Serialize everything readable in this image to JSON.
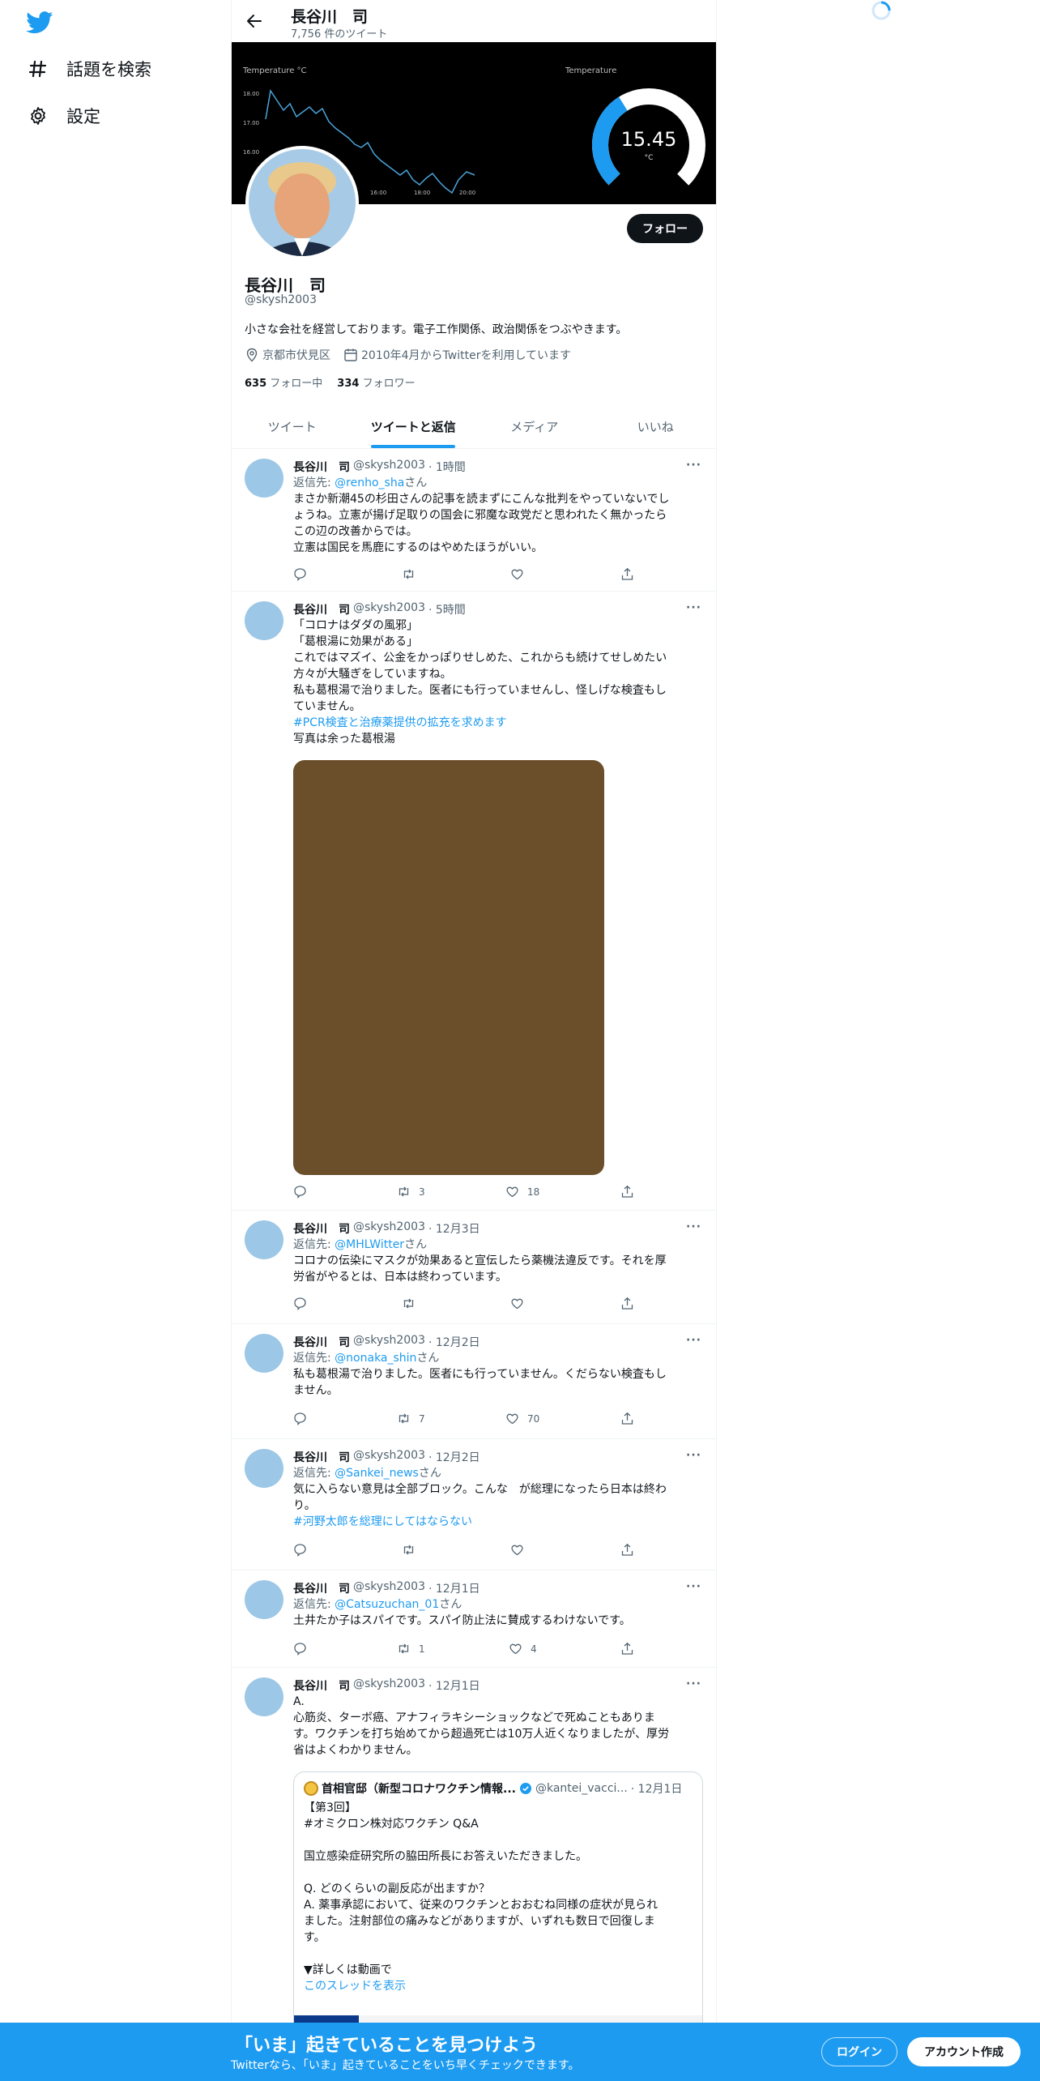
{
  "nav": {
    "logo_icon": "twitter-bird-icon",
    "items": [
      {
        "icon": "hash-icon",
        "label": "話題を検索"
      },
      {
        "icon": "gear-icon",
        "label": "設定"
      }
    ]
  },
  "header": {
    "name": "長谷川　司",
    "tweet_count": "7,756 件のツイート"
  },
  "banner": {
    "left_label": "Temperature °C",
    "right_label": "Temperature",
    "y_ticks": [
      "18.00",
      "17.00",
      "16.00"
    ],
    "x_ticks": [
      "16:00",
      "18:00",
      "20:00"
    ],
    "gauge_value": "15.45",
    "gauge_unit": "°C"
  },
  "profile": {
    "follow_label": "フォロー",
    "name": "長谷川　司",
    "handle": "@skysh2003",
    "bio": "小さな会社を経営しております。電子工作関係、政治関係をつぶやきます。",
    "location": "京都市伏見区",
    "joined": "2010年4月からTwitterを利用しています",
    "following_count": "635",
    "following_label": "フォロー中",
    "followers_count": "334",
    "followers_label": "フォロワー"
  },
  "tabs": [
    {
      "label": "ツイート"
    },
    {
      "label": "ツイートと返信"
    },
    {
      "label": "メディア"
    },
    {
      "label": "いいね"
    }
  ],
  "tweets": [
    {
      "name": "長谷川　司",
      "handle": "@skysh2003",
      "time": "· 1時間",
      "reply_prefix": "返信先: ",
      "reply_to": "@renho_sha",
      "reply_suffix": "さん",
      "lines": [
        "まさか新潮45の杉田さんの記事を読まずにこんな批判をやっていないでし",
        "ょうね。立憲が揚げ足取りの国会に邪魔な政党だと思われたく無かったら",
        "この辺の改善からでは。",
        "立憲は国民を馬鹿にするのはやめたほうがいい。"
      ],
      "retweets": "",
      "likes": ""
    },
    {
      "name": "長谷川　司",
      "handle": "@skysh2003",
      "time": "· 5時間",
      "lines": [
        "「コロナはダダの風邪」",
        "「葛根湯に効果がある」",
        "これではマズイ、公金をかっぽりせしめた、これからも続けてせしめたい",
        "方々が大騒ぎをしていますね。",
        "私も葛根湯で治りました。医者にも行っていませんし、怪しげな検査もし",
        "ていません。"
      ],
      "hashtag": "#PCR検査と治療薬提供の拡充を求めます",
      "after": "写真は余った葛根湯",
      "retweets": "3",
      "likes": "18"
    },
    {
      "name": "長谷川　司",
      "handle": "@skysh2003",
      "time": "· 12月3日",
      "reply_prefix": "返信先: ",
      "reply_to": "@MHLWitter",
      "reply_suffix": "さん",
      "lines": [
        "コロナの伝染にマスクが効果あると宣伝したら薬機法違反です。それを厚",
        "労省がやるとは、日本は終わっています。"
      ],
      "retweets": "",
      "likes": ""
    },
    {
      "name": "長谷川　司",
      "handle": "@skysh2003",
      "time": "· 12月2日",
      "reply_prefix": "返信先: ",
      "reply_to": "@nonaka_shin",
      "reply_suffix": "さん",
      "lines": [
        "私も葛根湯で治りました。医者にも行っていません。くだらない検査もし",
        "ません。"
      ],
      "retweets": "7",
      "likes": "70"
    },
    {
      "name": "長谷川　司",
      "handle": "@skysh2003",
      "time": "· 12月2日",
      "reply_prefix": "返信先: ",
      "reply_to": "@Sankei_news",
      "reply_suffix": "さん",
      "lines": [
        "気に入らない意見は全部ブロック。こんな　が総理になったら日本は終わ",
        "り。"
      ],
      "hashtag": "#河野太郎を総理にしてはならない",
      "retweets": "",
      "likes": ""
    },
    {
      "name": "長谷川　司",
      "handle": "@skysh2003",
      "time": "· 12月1日",
      "reply_prefix": "返信先: ",
      "reply_to": "@Catsuzuchan_01",
      "reply_suffix": "さん",
      "lines": [
        "土井たか子はスパイです。スパイ防止法に賛成するわけないです。"
      ],
      "retweets": "1",
      "likes": "4"
    },
    {
      "name": "長谷川　司",
      "handle": "@skysh2003",
      "time": "· 12月1日",
      "lines": [
        "A.",
        "心筋炎、ターボ癌、アナフィラキシーショックなどで死ぬこともありま",
        "す。ワクチンを打ち始めてから超過死亡は10万人近くなりましたが、厚労",
        "省はよくわかりません。"
      ]
    }
  ],
  "quote": {
    "name": "首相官邸（新型コロナワクチン情報...",
    "handle": "@kantei_vacci...",
    "time": "· 12月1日",
    "lines": [
      "【第3回】",
      "#オミクロン株対応ワクチン Q&A",
      "",
      "国立感染症研究所の脇田所長にお答えいただきました。",
      "",
      "Q. どのくらいの副反応が出ますか？",
      "A. 薬事承認において、従来のワクチンとおおむね同様の症状が見られ",
      "ました。注射部位の痛みなどがありますが、いずれも数日で回復しま",
      "す。",
      "",
      "▼詳しくは動画で"
    ],
    "thread_link": "このスレッドを表示"
  },
  "bottom_bar": {
    "title": "「いま」起きていることを見つけよう",
    "subtitle": "Twitterなら、「いま」起きていることをいち早くチェックできます。",
    "login_label": "ログイン",
    "signup_label": "アカウント作成"
  },
  "colors": {
    "accent": "#1d9bf0",
    "text": "#0f1419",
    "muted": "#536471"
  }
}
